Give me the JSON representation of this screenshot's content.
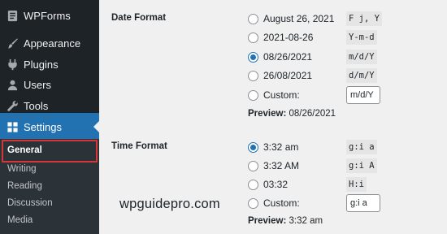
{
  "sidebar": {
    "items": [
      {
        "label": "WPForms",
        "icon": "wpforms-icon"
      },
      {
        "label": "Appearance",
        "icon": "paintbrush-icon"
      },
      {
        "label": "Plugins",
        "icon": "plugin-icon"
      },
      {
        "label": "Users",
        "icon": "users-icon"
      },
      {
        "label": "Tools",
        "icon": "wrench-icon"
      },
      {
        "label": "Settings",
        "icon": "settings-icon",
        "active": true
      }
    ],
    "submenu": [
      "General",
      "Writing",
      "Reading",
      "Discussion",
      "Media"
    ],
    "current_submenu": "General"
  },
  "date_format": {
    "title": "Date Format",
    "options": [
      {
        "label": "August 26, 2021",
        "code": "F j, Y",
        "checked": false
      },
      {
        "label": "2021-08-26",
        "code": "Y-m-d",
        "checked": false
      },
      {
        "label": "08/26/2021",
        "code": "m/d/Y",
        "checked": true
      },
      {
        "label": "26/08/2021",
        "code": "d/m/Y",
        "checked": false
      },
      {
        "label": "Custom:",
        "value": "m/d/Y",
        "checked": false
      }
    ],
    "preview_label": "Preview:",
    "preview_value": "08/26/2021"
  },
  "time_format": {
    "title": "Time Format",
    "options": [
      {
        "label": "3:32 am",
        "code": "g:i a",
        "checked": true
      },
      {
        "label": "3:32 AM",
        "code": "g:i A",
        "checked": false
      },
      {
        "label": "03:32",
        "code": "H:i",
        "checked": false
      },
      {
        "label": "Custom:",
        "value": "g:i a",
        "checked": false
      }
    ],
    "preview_label": "Preview:",
    "preview_value": "3:32 am"
  },
  "watermark": "wpguidepro.com",
  "colors": {
    "sidebar": "#1d2327",
    "active": "#2271b1",
    "highlight": "#d63638"
  }
}
